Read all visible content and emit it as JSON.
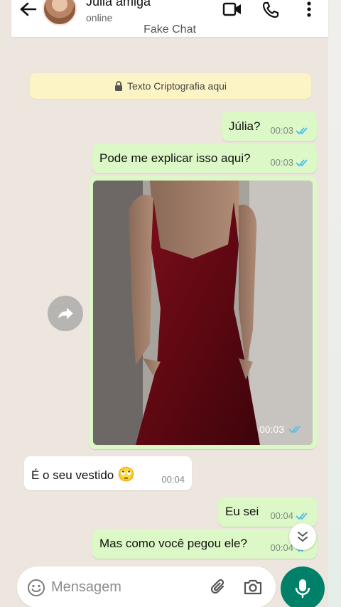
{
  "header": {
    "contact_name": "Júlia amiga",
    "status": "online",
    "caption": "Fake Chat"
  },
  "encryption_banner": {
    "text": "Texto Criptografia aqui"
  },
  "messages": [
    {
      "direction": "out",
      "text": "Júlia?",
      "time": "00:03"
    },
    {
      "direction": "out",
      "text": "Pode me explicar isso aqui?",
      "time": "00:03"
    },
    {
      "direction": "out",
      "type": "image",
      "caption": "",
      "time": "00:03"
    },
    {
      "direction": "in",
      "text": "É o seu vestido",
      "emoji": "🙄",
      "time": "00:04"
    },
    {
      "direction": "out",
      "text": "Eu sei",
      "time": "00:04"
    },
    {
      "direction": "out",
      "text": "Mas como você pegou ele?",
      "time": "00:04"
    }
  ],
  "input": {
    "placeholder": "Mensagem",
    "value": ""
  },
  "icons": {
    "back": "arrow-left-icon",
    "video": "video-camera-icon",
    "call": "phone-icon",
    "menu": "more-vertical-icon",
    "lock": "lock-icon",
    "read": "double-check-icon",
    "forward": "forward-icon",
    "scroll_down": "chevron-double-down-icon",
    "emoji": "smiley-icon",
    "attach": "paperclip-icon",
    "camera": "camera-icon",
    "mic": "microphone-icon"
  },
  "colors": {
    "outgoing_bubble": "#dcf8c6",
    "incoming_bubble": "#ffffff",
    "read_ticks": "#53bdeb",
    "accent": "#008069",
    "banner": "#fdf4c5"
  }
}
